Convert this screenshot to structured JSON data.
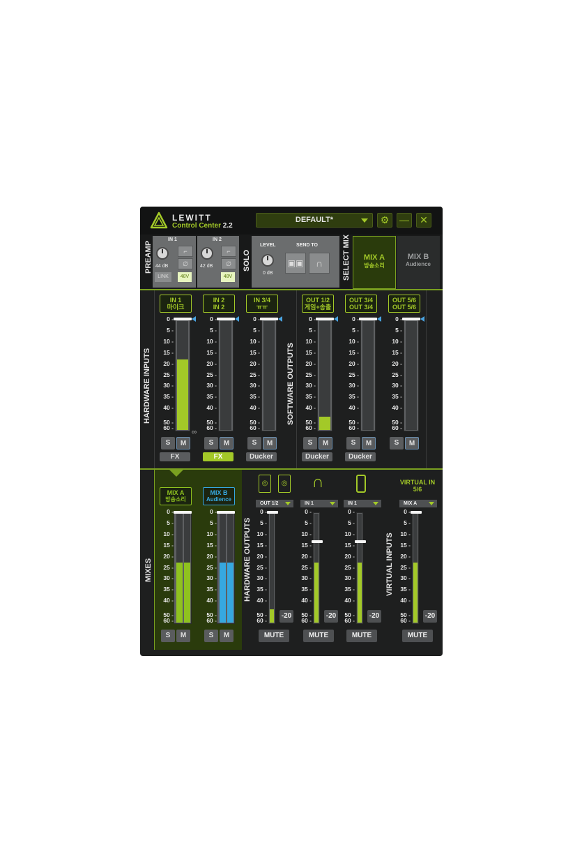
{
  "brand": {
    "name": "LEWITT",
    "product": "Control Center",
    "version": "2.2"
  },
  "preset": {
    "selected": "DEFAULT*"
  },
  "sections": {
    "preamp": "PREAMP",
    "solo": "SOLO",
    "select_mix": "SELECT MIX",
    "hardware_inputs": "HARDWARE INPUTS",
    "software_outputs": "SOFTWARE OUTPUTS",
    "mixes": "MIXES",
    "hardware_outputs": "HARDWARE OUTPUTS",
    "virtual_inputs": "VIRTUAL INPUTS"
  },
  "preamp": {
    "in1": {
      "title": "IN 1",
      "gain": "44 dB",
      "link": "LINK",
      "phantom": "48V"
    },
    "in2": {
      "title": "IN 2",
      "gain": "42 dB",
      "phantom": "48V"
    }
  },
  "solo": {
    "level_label": "LEVEL",
    "send_to_label": "SEND TO",
    "level": "0 dB"
  },
  "mix_tabs": [
    {
      "name": "MIX A",
      "sub": "방송소리"
    },
    {
      "name": "MIX B",
      "sub": "Audience"
    }
  ],
  "scale": [
    "0",
    "5",
    "10",
    "15",
    "20",
    "25",
    "30",
    "35",
    "40",
    "50",
    "60"
  ],
  "channels": [
    {
      "l1": "IN 1",
      "l2": "마이크",
      "level": 0.65,
      "tag": "FX",
      "tag_active": false
    },
    {
      "l1": "IN 2",
      "l2": "IN 2",
      "level": 0.0,
      "tag": "FX",
      "tag_active": true
    },
    {
      "l1": "IN 3/4",
      "l2": "ㅠㅠ",
      "level": 0.0,
      "tag": "Ducker",
      "tag_active": false
    },
    {
      "l1": "OUT 1/2",
      "l2": "게임+송출",
      "level": 0.12,
      "tag": "Ducker",
      "tag_active": false
    },
    {
      "l1": "OUT 3/4",
      "l2": "OUT 3/4",
      "level": 0.0,
      "tag": "Ducker",
      "tag_active": false
    },
    {
      "l1": "OUT 5/6",
      "l2": "OUT 5/6",
      "level": 0.0,
      "tag": "",
      "tag_active": false
    }
  ],
  "solo_label": "S",
  "mute_label": "M",
  "mix_strips": [
    {
      "l1": "MIX A",
      "l2": "방송소리",
      "level": 0.55,
      "color": "#8fc21f"
    },
    {
      "l1": "MIX B",
      "l2": "Audience",
      "level": 0.55,
      "color": "#36a8e0"
    }
  ],
  "outputs": [
    {
      "source": "OUT 1/2",
      "level": 0.12,
      "db": "-20",
      "mute": "MUTE"
    },
    {
      "source": "IN 1",
      "level": 0.55,
      "db": "-20",
      "mute": "MUTE"
    },
    {
      "source": "IN 1",
      "level": 0.55,
      "db": "-20",
      "mute": "MUTE"
    },
    {
      "source": "MIX A",
      "title": "VIRTUAL IN 5/6",
      "level": 0.55,
      "db": "-20",
      "mute": "MUTE"
    }
  ],
  "colors": {
    "accent": "#a3c928",
    "blue": "#36a8e0",
    "bg": "#1e1f1f"
  }
}
